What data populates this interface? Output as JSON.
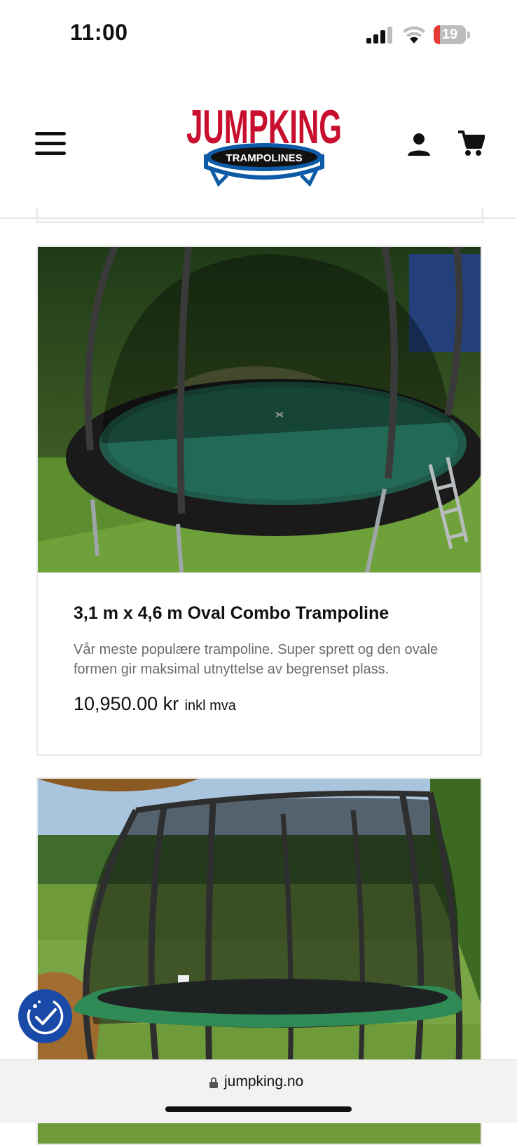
{
  "status_bar": {
    "time": "11:00",
    "battery_level": "19",
    "battery_fraction": 0.19
  },
  "header": {
    "logo_text": "JUMPKING",
    "logo_subtext": "TRAMPOLINES",
    "brand_color": "#c8102e",
    "secondary_color": "#0d5aa7"
  },
  "products": [
    {
      "name": "3,1 m x 4,6 m Oval Combo Trampoline",
      "description": "Vår meste populære trampoline. Super sprett og den ovale formen gir maksimal utnyttelse av begrenset plass.",
      "price": "10,950.00 kr",
      "price_suffix": "inkl mva"
    },
    {
      "name": "",
      "description": "",
      "price": "",
      "price_suffix": ""
    }
  ],
  "browser": {
    "url": "jumpking.no"
  },
  "icons": {
    "menu": "menu-icon",
    "account": "account-icon",
    "cart": "cart-icon",
    "accessibility": "accessibility-icon",
    "lock": "lock-icon"
  }
}
